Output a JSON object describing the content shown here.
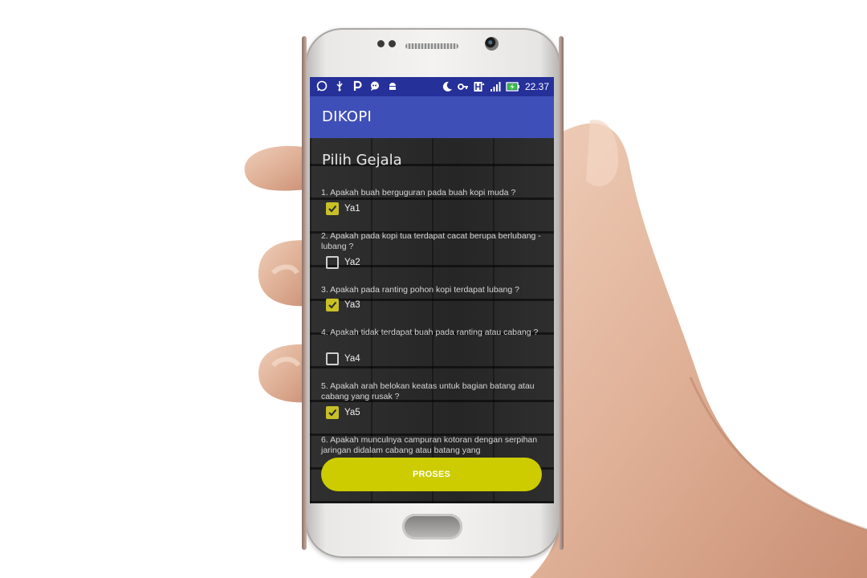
{
  "status_bar": {
    "time": "22.37",
    "left_icons": [
      "whatsapp-icon",
      "usb-icon",
      "p-app-icon",
      "chat-bubble-icon",
      "android-debug-icon"
    ],
    "right_icons": [
      "moon-icon",
      "key-icon",
      "data-h-icon",
      "signal-icon",
      "battery-charging-icon"
    ]
  },
  "app_bar": {
    "title": "DIKOPI",
    "color": "#3f4fb8"
  },
  "page": {
    "title": "Pilih Gejala"
  },
  "questions": [
    {
      "text": "1. Apakah buah berguguran pada buah kopi muda ?",
      "option": "Ya1",
      "checked": true
    },
    {
      "text": "2. Apakah pada kopi tua terdapat cacat berupa berlubang - lubang ?",
      "option": "Ya2",
      "checked": false
    },
    {
      "text": "3. Apakah pada ranting pohon kopi terdapat lubang ?",
      "option": "Ya3",
      "checked": true
    },
    {
      "text": "4. Apakah tidak terdapat buah pada ranting atau cabang ?",
      "option": "Ya4",
      "checked": false
    },
    {
      "text": "5. Apakah arah belokan keatas untuk bagian batang atau cabang yang rusak ?",
      "option": "Ya5",
      "checked": true
    },
    {
      "text": "6. Apakah munculnya campuran kotoran dengan serpihan jaringan didalam cabang atau batang yang",
      "option": "",
      "checked": false
    }
  ],
  "button": {
    "label": "PROSES",
    "color": "#cccc00"
  }
}
